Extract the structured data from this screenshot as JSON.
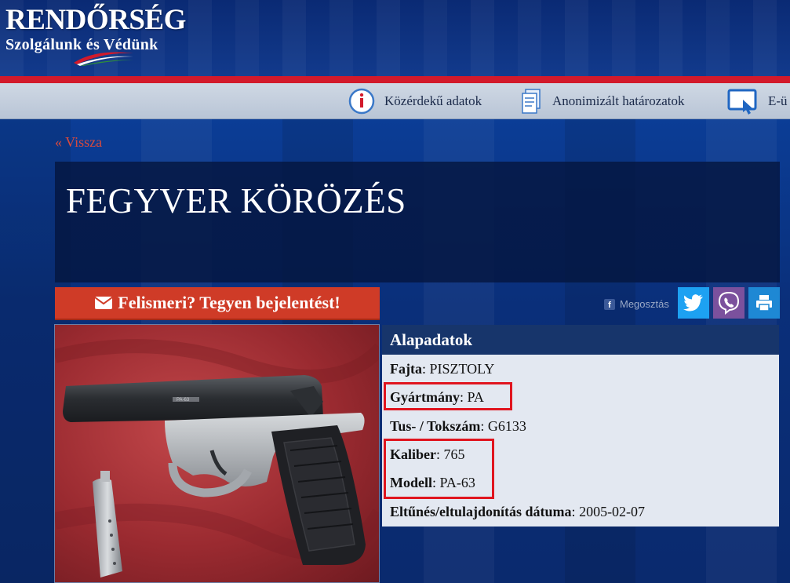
{
  "header": {
    "logo_title": "RENDŐRSÉG",
    "logo_subtitle": "Szolgálunk és Védünk"
  },
  "topnav": {
    "items": [
      {
        "label": "Közérdekű adatok",
        "icon": "info-icon"
      },
      {
        "label": "Anonimizált határozatok",
        "icon": "document-icon"
      },
      {
        "label": "E-ü",
        "icon": "tablet-touch-icon"
      }
    ]
  },
  "page": {
    "back_label": "« Vissza",
    "title": "FEGYVER KÖRÖZÉS",
    "report_button": "Felismeri? Tegyen bejelentést!",
    "share_label": "Megosztás"
  },
  "details": {
    "heading": "Alapadatok",
    "rows": [
      {
        "key": "Fajta",
        "value": "PISZTOLY"
      },
      {
        "key": "Gyártmány",
        "value": "PA"
      },
      {
        "key": "Tus- / Tokszám",
        "value": "G6133"
      },
      {
        "key": "Kaliber",
        "value": "765"
      },
      {
        "key": "Modell",
        "value": "PA-63"
      },
      {
        "key": "Eltűnés/eltulajdonítás dátuma",
        "value": "2005-02-07"
      }
    ]
  },
  "photo": {
    "engraving": "PA-63"
  },
  "colors": {
    "brand_blue": "#0b2a6b",
    "red_accent": "#d21a2b",
    "report_button": "#cf3b27",
    "highlight": "#e0151f",
    "twitter": "#1da1f2",
    "viber": "#7b519d",
    "print": "#1e88d4"
  }
}
